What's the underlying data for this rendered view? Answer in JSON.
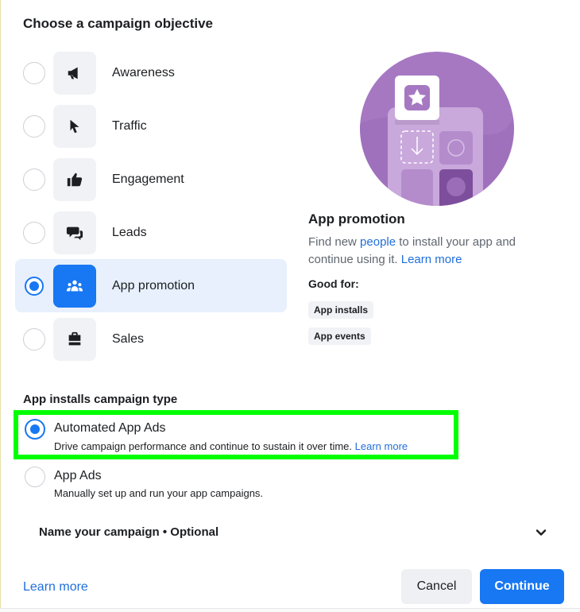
{
  "dialog": {
    "title": "Choose a campaign objective"
  },
  "objectives": [
    {
      "label": "Awareness",
      "icon": "megaphone-icon",
      "selected": false
    },
    {
      "label": "Traffic",
      "icon": "cursor-icon",
      "selected": false
    },
    {
      "label": "Engagement",
      "icon": "thumbs-up-icon",
      "selected": false
    },
    {
      "label": "Leads",
      "icon": "chat-bubbles-icon",
      "selected": false
    },
    {
      "label": "App promotion",
      "icon": "people-group-icon",
      "selected": true
    },
    {
      "label": "Sales",
      "icon": "shopping-bag-icon",
      "selected": false
    }
  ],
  "detail": {
    "title": "App promotion",
    "desc_before": "Find new ",
    "desc_link": "people",
    "desc_after": " to install your app and continue using it. ",
    "learn_more": "Learn more",
    "good_for": "Good for:",
    "tags": [
      "App installs",
      "App events"
    ]
  },
  "campaign_type": {
    "title": "App installs campaign type",
    "options": [
      {
        "title": "Automated App Ads",
        "desc": "Drive campaign performance and continue to sustain it over time.",
        "link": "Learn more",
        "selected": true
      },
      {
        "title": "App Ads",
        "desc": "Manually set up and run your app campaigns.",
        "selected": false
      }
    ]
  },
  "name_section": {
    "label": "Name your campaign • Optional"
  },
  "footer": {
    "learn_more": "Learn more",
    "cancel": "Cancel",
    "continue": "Continue"
  },
  "colors": {
    "accent": "#1877f2",
    "selected_bg": "#e7f0fc",
    "highlight": "#00ff00",
    "illustration": "#a678c2"
  }
}
